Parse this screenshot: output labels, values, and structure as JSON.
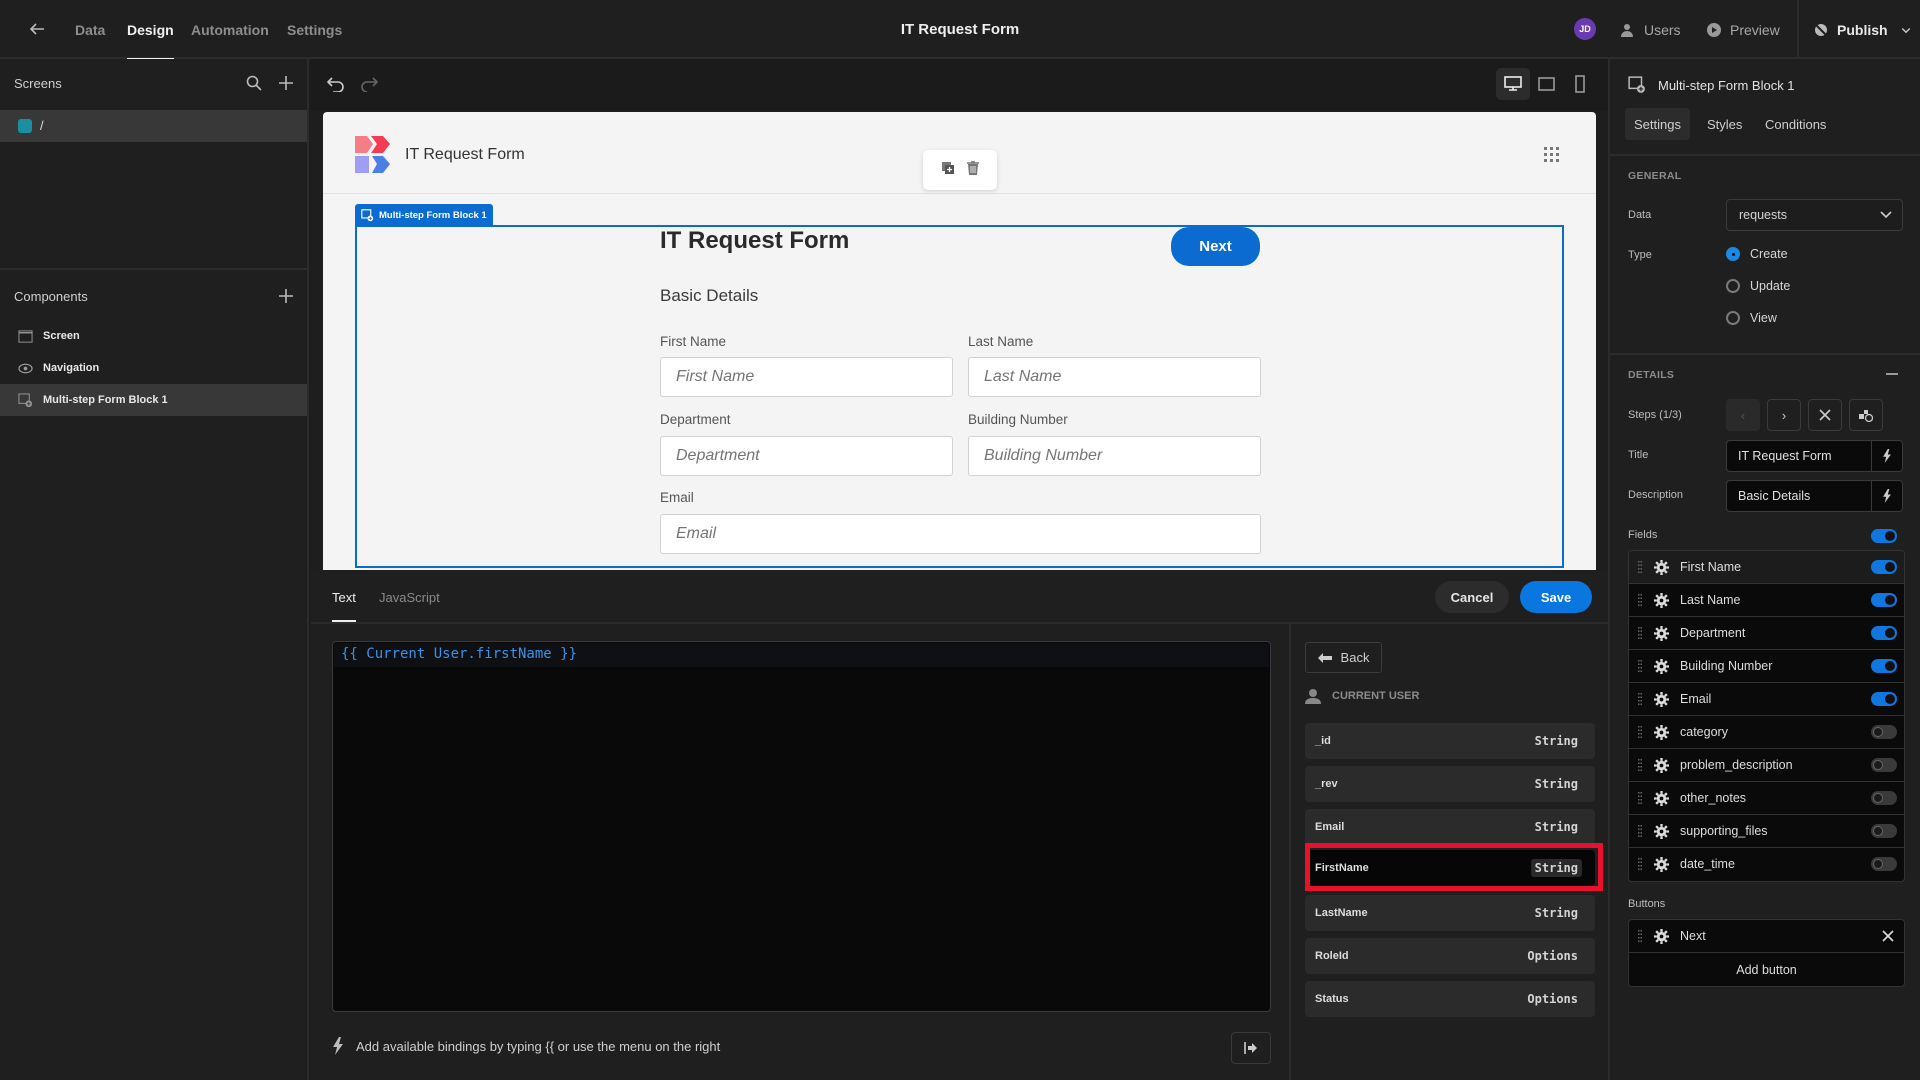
{
  "topbar": {
    "back_icon": "arrow-left-icon",
    "nav": [
      {
        "label": "Data",
        "active": false
      },
      {
        "label": "Design",
        "active": true
      },
      {
        "label": "Automation",
        "active": false
      },
      {
        "label": "Settings",
        "active": false
      }
    ],
    "app_title": "IT Request Form",
    "avatar_initials": "JD",
    "users_label": "Users",
    "preview_label": "Preview",
    "publish_label": "Publish"
  },
  "sidebar": {
    "screens_title": "Screens",
    "screens": [
      {
        "label": "/",
        "color": "#1a8fa0",
        "selected": true
      }
    ],
    "components_title": "Components",
    "components": [
      {
        "label": "Screen",
        "icon": "screen-icon",
        "selected": false
      },
      {
        "label": "Navigation",
        "icon": "eye-icon",
        "selected": false
      },
      {
        "label": "Multi-step Form Block 1",
        "icon": "form-block-icon",
        "selected": true
      }
    ]
  },
  "preview": {
    "app_name": "IT Request Form",
    "block_tag": "Multi-step Form Block 1",
    "form_title": "IT Request Form",
    "form_description": "Basic Details",
    "next_button": "Next",
    "fields": [
      {
        "label": "First Name",
        "placeholder": "First Name"
      },
      {
        "label": "Last Name",
        "placeholder": "Last Name"
      },
      {
        "label": "Department",
        "placeholder": "Department"
      },
      {
        "label": "Building Number",
        "placeholder": "Building Number"
      },
      {
        "label": "Email",
        "placeholder": "Email"
      }
    ]
  },
  "binding_panel": {
    "tabs": [
      {
        "label": "Text",
        "active": true
      },
      {
        "label": "JavaScript",
        "active": false
      }
    ],
    "cancel_label": "Cancel",
    "save_label": "Save",
    "editor_value": "{{ Current User.firstName }}",
    "hint": "Add available bindings by typing {{ or use the menu on the right",
    "back_label": "Back",
    "section_title": "CURRENT USER",
    "bindings": [
      {
        "name": "_id",
        "type": "String",
        "highlighted": false
      },
      {
        "name": "_rev",
        "type": "String",
        "highlighted": false
      },
      {
        "name": "Email",
        "type": "String",
        "highlighted": false
      },
      {
        "name": "FirstName",
        "type": "String",
        "highlighted": true
      },
      {
        "name": "LastName",
        "type": "String",
        "highlighted": false
      },
      {
        "name": "RoleId",
        "type": "Options",
        "highlighted": false
      },
      {
        "name": "Status",
        "type": "Options",
        "highlighted": false
      }
    ],
    "highlight_color": "#e8102a"
  },
  "settings": {
    "component_name": "Multi-step Form Block 1",
    "tabs": [
      {
        "label": "Settings",
        "active": true
      },
      {
        "label": "Styles",
        "active": false
      },
      {
        "label": "Conditions",
        "active": false
      }
    ],
    "general_title": "GENERAL",
    "data_label": "Data",
    "data_value": "requests",
    "type_label": "Type",
    "type_options": [
      {
        "label": "Create",
        "selected": true
      },
      {
        "label": "Update",
        "selected": false
      },
      {
        "label": "View",
        "selected": false
      }
    ],
    "details_title": "DETAILS",
    "steps_label": "Steps (1/3)",
    "title_label": "Title",
    "title_value": "IT Request Form",
    "description_label": "Description",
    "description_value": "Basic Details",
    "fields_label": "Fields",
    "fields_enabled": true,
    "fields": [
      {
        "label": "First Name",
        "enabled": true
      },
      {
        "label": "Last Name",
        "enabled": true
      },
      {
        "label": "Department",
        "enabled": true
      },
      {
        "label": "Building Number",
        "enabled": true
      },
      {
        "label": "Email",
        "enabled": true
      },
      {
        "label": "category",
        "enabled": false
      },
      {
        "label": "problem_description",
        "enabled": false
      },
      {
        "label": "other_notes",
        "enabled": false
      },
      {
        "label": "supporting_files",
        "enabled": false
      },
      {
        "label": "date_time",
        "enabled": false
      }
    ],
    "buttons_label": "Buttons",
    "buttons": [
      {
        "label": "Next"
      }
    ],
    "add_button_label": "Add button"
  },
  "colors": {
    "accent": "#0b6bd1",
    "save": "#0a76e0",
    "avatar": "#6a3bb0"
  }
}
